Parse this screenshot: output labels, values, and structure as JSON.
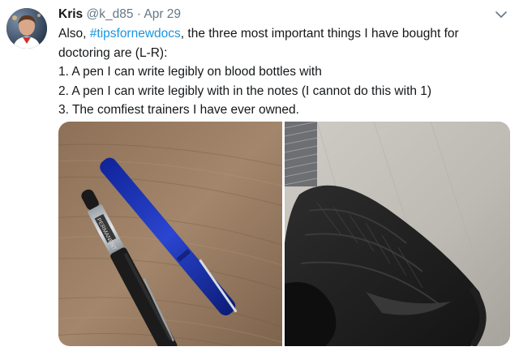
{
  "tweet": {
    "author_name": "Kris",
    "author_handle": "@k_d85",
    "separator": " · ",
    "date": "Apr 29",
    "text_lines": {
      "line1_prefix": "Also, ",
      "hashtag": "#tipsfornewdocs",
      "line1_suffix": ", the three most important things I have bought for",
      "line2": "doctoring are (L-R):",
      "line3": "1. A pen I can write legibly on blood bottles with",
      "line4": "2. A pen I can write legibly with in the notes (I cannot do this with 1)",
      "line5": "3. The comfiest trainers I have ever owned."
    },
    "pen_print": "PERMANENT"
  },
  "colors": {
    "link": "#1b95e0",
    "secondary_text": "#657786",
    "primary_text": "#14171a"
  },
  "icons": {
    "menu": "chevron-down-icon"
  }
}
